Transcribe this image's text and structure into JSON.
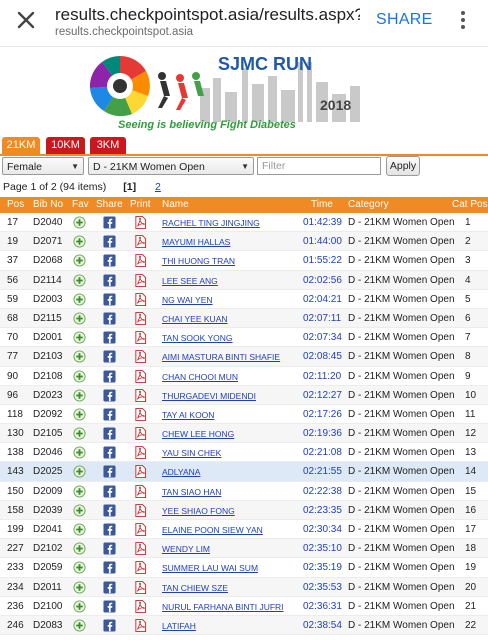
{
  "browser": {
    "url": "results.checkpointspot.asia/results.aspx?...",
    "host": "results.checkpointspot.asia",
    "share_label": "SHARE"
  },
  "banner": {
    "title": "SJMC RUN",
    "year": "2018",
    "tagline": "Seeing is believing Fight Diabetes"
  },
  "tabs": [
    "21KM",
    "10KM",
    "3KM"
  ],
  "filters": {
    "gender": "Female",
    "category": "D - 21KM Women Open",
    "filter_placeholder": "Filter",
    "apply_label": "Apply"
  },
  "pager": {
    "summary": "Page 1 of 2 (94 items)",
    "current": "[1]",
    "next": "2"
  },
  "table": {
    "headers": [
      "Pos",
      "Bib No",
      "Fav",
      "Share",
      "Print",
      "Name",
      "Time",
      "Category",
      "Cat Pos"
    ],
    "rows": [
      {
        "pos": "17",
        "bib": "D2040",
        "name": "RACHEL TING JINGJING",
        "time": "01:42:39",
        "category": "D - 21KM Women Open",
        "cat_pos": "1"
      },
      {
        "pos": "19",
        "bib": "D2071",
        "name": "MAYUMI HALLAS",
        "time": "01:44:00",
        "category": "D - 21KM Women Open",
        "cat_pos": "2"
      },
      {
        "pos": "37",
        "bib": "D2068",
        "name": "THI HUONG TRAN",
        "time": "01:55:22",
        "category": "D - 21KM Women Open",
        "cat_pos": "3"
      },
      {
        "pos": "56",
        "bib": "D2114",
        "name": "LEE SEE ANG",
        "time": "02:02:56",
        "category": "D - 21KM Women Open",
        "cat_pos": "4"
      },
      {
        "pos": "59",
        "bib": "D2003",
        "name": "NG WAI YEN",
        "time": "02:04:21",
        "category": "D - 21KM Women Open",
        "cat_pos": "5"
      },
      {
        "pos": "68",
        "bib": "D2115",
        "name": "CHAI YEE KUAN",
        "time": "02:07:11",
        "category": "D - 21KM Women Open",
        "cat_pos": "6"
      },
      {
        "pos": "70",
        "bib": "D2001",
        "name": "TAN SOOK YONG",
        "time": "02:07:34",
        "category": "D - 21KM Women Open",
        "cat_pos": "7"
      },
      {
        "pos": "77",
        "bib": "D2103",
        "name": "AIMI MASTURA BINTI SHAFIE",
        "time": "02:08:45",
        "category": "D - 21KM Women Open",
        "cat_pos": "8"
      },
      {
        "pos": "90",
        "bib": "D2108",
        "name": "CHAN CHOOI MUN",
        "time": "02:11:20",
        "category": "D - 21KM Women Open",
        "cat_pos": "9"
      },
      {
        "pos": "96",
        "bib": "D2023",
        "name": "THURGADEVI MIDENDI",
        "time": "02:12:27",
        "category": "D - 21KM Women Open",
        "cat_pos": "10"
      },
      {
        "pos": "118",
        "bib": "D2092",
        "name": "TAY AI KOON",
        "time": "02:17:26",
        "category": "D - 21KM Women Open",
        "cat_pos": "11"
      },
      {
        "pos": "130",
        "bib": "D2105",
        "name": "CHEW LEE HONG",
        "time": "02:19:36",
        "category": "D - 21KM Women Open",
        "cat_pos": "12"
      },
      {
        "pos": "138",
        "bib": "D2046",
        "name": "YAU SIN CHEK",
        "time": "02:21:08",
        "category": "D - 21KM Women Open",
        "cat_pos": "13"
      },
      {
        "pos": "143",
        "bib": "D2025",
        "name": "ADLYANA",
        "time": "02:21:55",
        "category": "D - 21KM Women Open",
        "cat_pos": "14"
      },
      {
        "pos": "150",
        "bib": "D2009",
        "name": "TAN SIAO HAN",
        "time": "02:22:38",
        "category": "D - 21KM Women Open",
        "cat_pos": "15"
      },
      {
        "pos": "158",
        "bib": "D2039",
        "name": "YEE SHIAO FONG",
        "time": "02:23:35",
        "category": "D - 21KM Women Open",
        "cat_pos": "16"
      },
      {
        "pos": "199",
        "bib": "D2041",
        "name": "ELAINE POON SIEW YAN",
        "time": "02:30:34",
        "category": "D - 21KM Women Open",
        "cat_pos": "17"
      },
      {
        "pos": "227",
        "bib": "D2102",
        "name": "WENDY LIM",
        "time": "02:35:10",
        "category": "D - 21KM Women Open",
        "cat_pos": "18"
      },
      {
        "pos": "233",
        "bib": "D2059",
        "name": "SUMMER LAU WAI SUM",
        "time": "02:35:19",
        "category": "D - 21KM Women Open",
        "cat_pos": "19"
      },
      {
        "pos": "234",
        "bib": "D2011",
        "name": "TAN CHIEW SZE",
        "time": "02:35:53",
        "category": "D - 21KM Women Open",
        "cat_pos": "20"
      },
      {
        "pos": "236",
        "bib": "D2100",
        "name": "NURUL FARHANA BINTI JUFRI",
        "time": "02:36:31",
        "category": "D - 21KM Women Open",
        "cat_pos": "21"
      },
      {
        "pos": "246",
        "bib": "D2083",
        "name": "LATIFAH",
        "time": "02:38:54",
        "category": "D - 21KM Women Open",
        "cat_pos": "22"
      }
    ],
    "highlighted_row": 13
  },
  "colors": {
    "accent_orange": "#f08a24",
    "tab_red": "#c9181e",
    "link_blue": "#1f3fbf",
    "highlight_row": "#dde9f7"
  },
  "icons": {
    "fav": "plus-circle-icon",
    "share": "facebook-icon",
    "print": "pdf-icon"
  }
}
